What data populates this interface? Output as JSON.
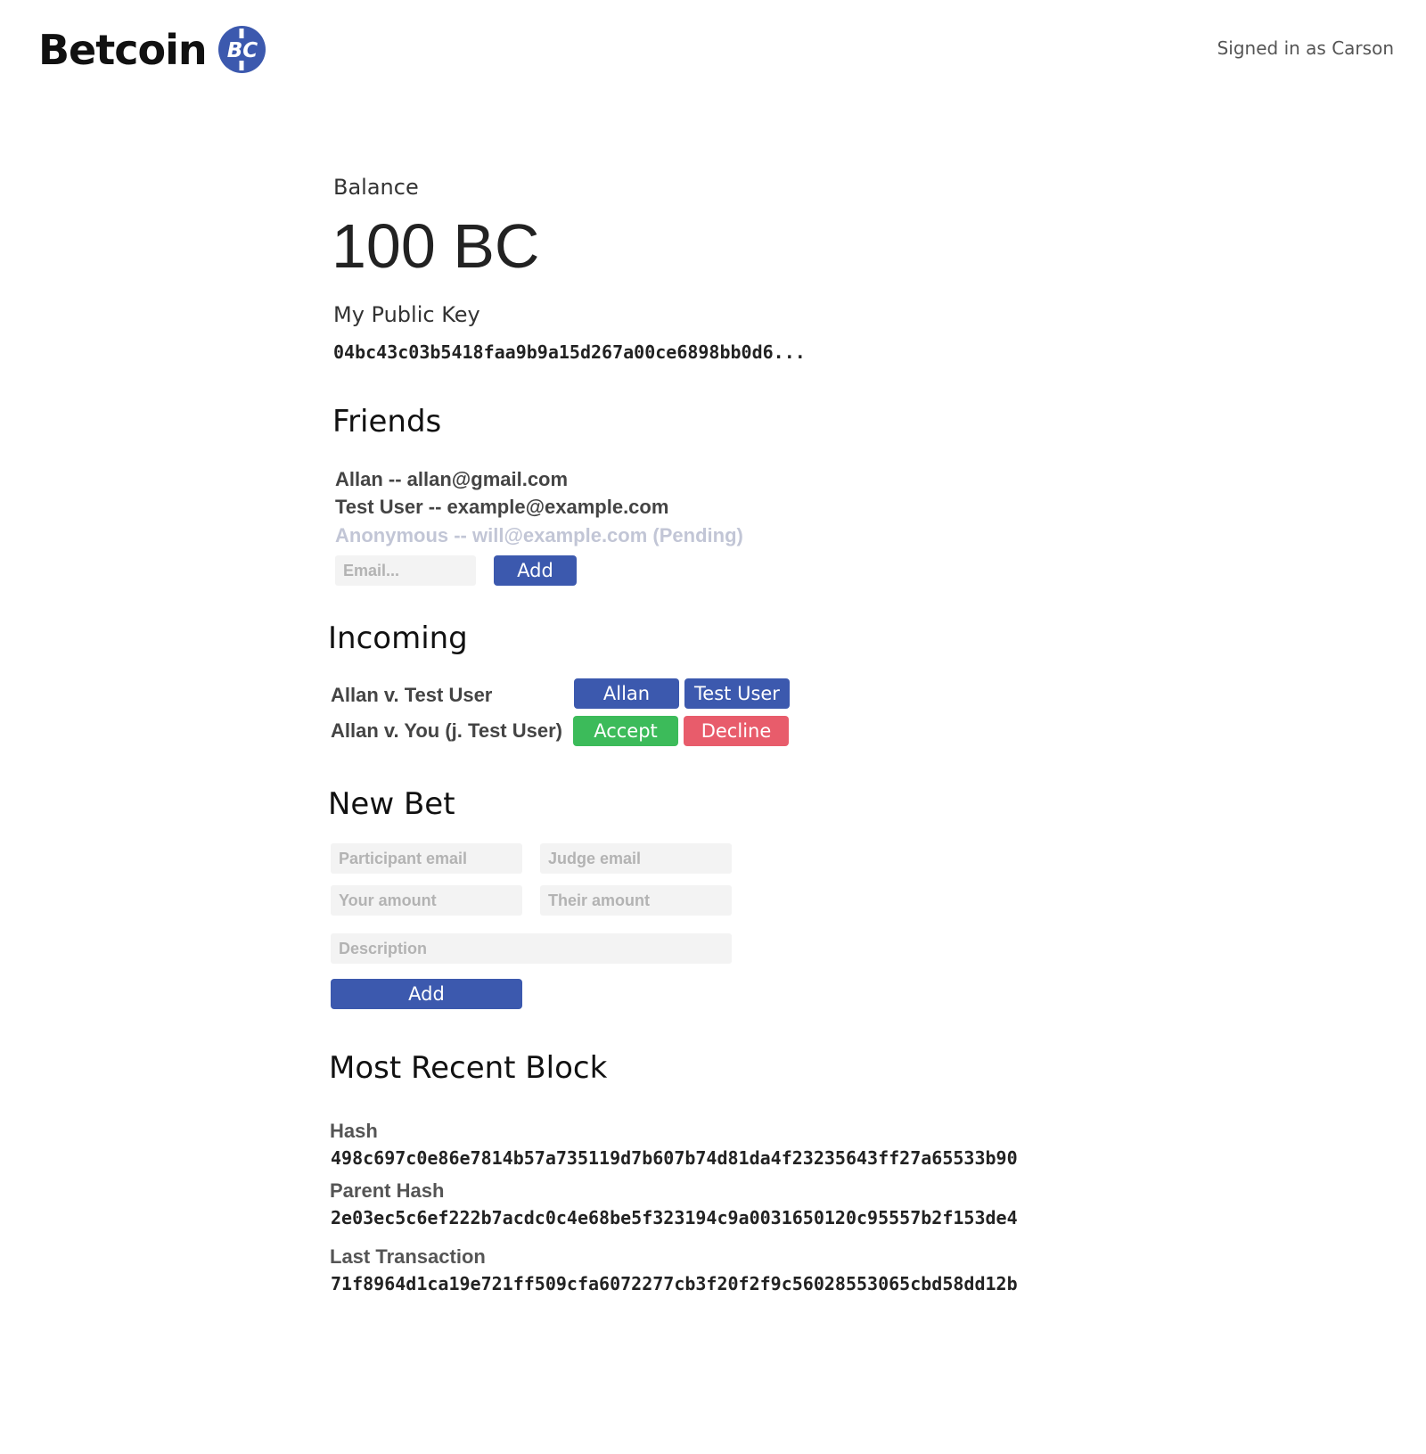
{
  "header": {
    "logo_text": "Betcoin",
    "logo_badge": "BC",
    "signed_in": "Signed in as Carson"
  },
  "balance": {
    "label": "Balance",
    "value": "100 BC"
  },
  "public_key": {
    "label": "My Public Key",
    "value": "04bc43c03b5418faa9b9a15d267a00ce6898bb0d6..."
  },
  "friends": {
    "title": "Friends",
    "items": [
      {
        "text": "Allan -- allan@gmail.com"
      },
      {
        "text": "Test User -- example@example.com"
      },
      {
        "text": "Anonymous -- will@example.com (Pending)"
      }
    ],
    "email_placeholder": "Email...",
    "add_label": "Add"
  },
  "incoming": {
    "title": "Incoming",
    "rows": [
      {
        "text": "Allan v. Test User",
        "btn1": "Allan",
        "btn2": "Test User"
      },
      {
        "text": "Allan v. You (j. Test User)",
        "btn1": "Accept",
        "btn2": "Decline"
      }
    ]
  },
  "new_bet": {
    "title": "New Bet",
    "participant_placeholder": "Participant email",
    "judge_placeholder": "Judge email",
    "your_amount_placeholder": "Your amount",
    "their_amount_placeholder": "Their amount",
    "description_placeholder": "Description",
    "add_label": "Add"
  },
  "block": {
    "title": "Most Recent Block",
    "hash_label": "Hash",
    "hash": "498c697c0e86e7814b57a735119d7b607b74d81da4f23235643ff27a65533b90",
    "parent_label": "Parent Hash",
    "parent_hash": "2e03ec5c6ef222b7acdc0c4e68be5f323194c9a0031650120c95557b2f153de4",
    "last_tx_label": "Last Transaction",
    "last_tx": "71f8964d1ca19e721ff509cfa6072277cb3f20f2f9c56028553065cbd58dd12b"
  },
  "colors": {
    "primary": "#3c59ae",
    "accept": "#3cbb5a",
    "decline": "#e85c6b",
    "pending_text": "#c2c6d6"
  }
}
